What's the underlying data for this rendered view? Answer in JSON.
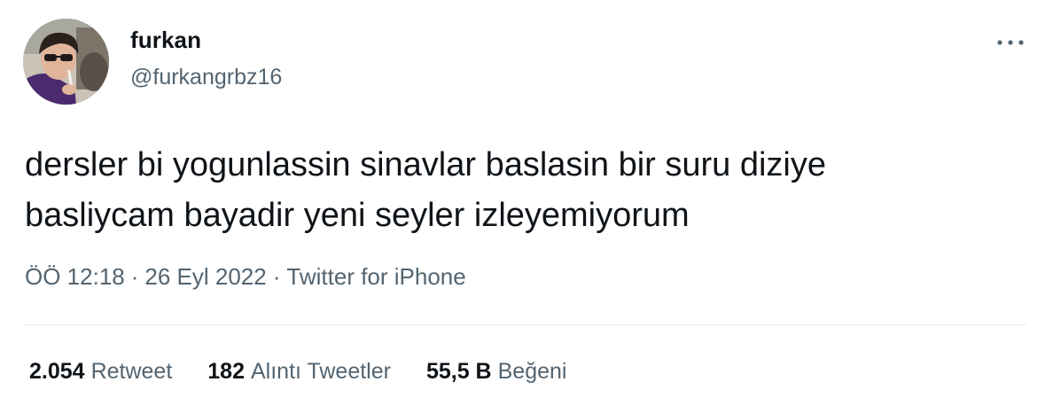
{
  "author": {
    "display_name": "furkan",
    "handle": "@furkangrbz16"
  },
  "tweet": {
    "text_lines": [
      "dersler bi yogunlassin sinavlar baslasin bir suru diziye",
      "basliycam bayadir yeni seyler izleyemiyorum"
    ],
    "time": "ÖÖ 12:18",
    "date": "26 Eyl 2022",
    "separator": "·",
    "source": "Twitter for iPhone"
  },
  "stats": {
    "retweets": {
      "count": "2.054",
      "label": "Retweet"
    },
    "quotes": {
      "count": "182",
      "label": "Alıntı Tweetler"
    },
    "likes": {
      "count": "55,5 B",
      "label": "Beğeni"
    }
  },
  "icons": {
    "more": "more-horizontal-icon",
    "avatar": "profile-photo"
  },
  "colors": {
    "primary_text": "#0f1419",
    "secondary_text": "#536471",
    "divider": "#e7e9ea"
  }
}
